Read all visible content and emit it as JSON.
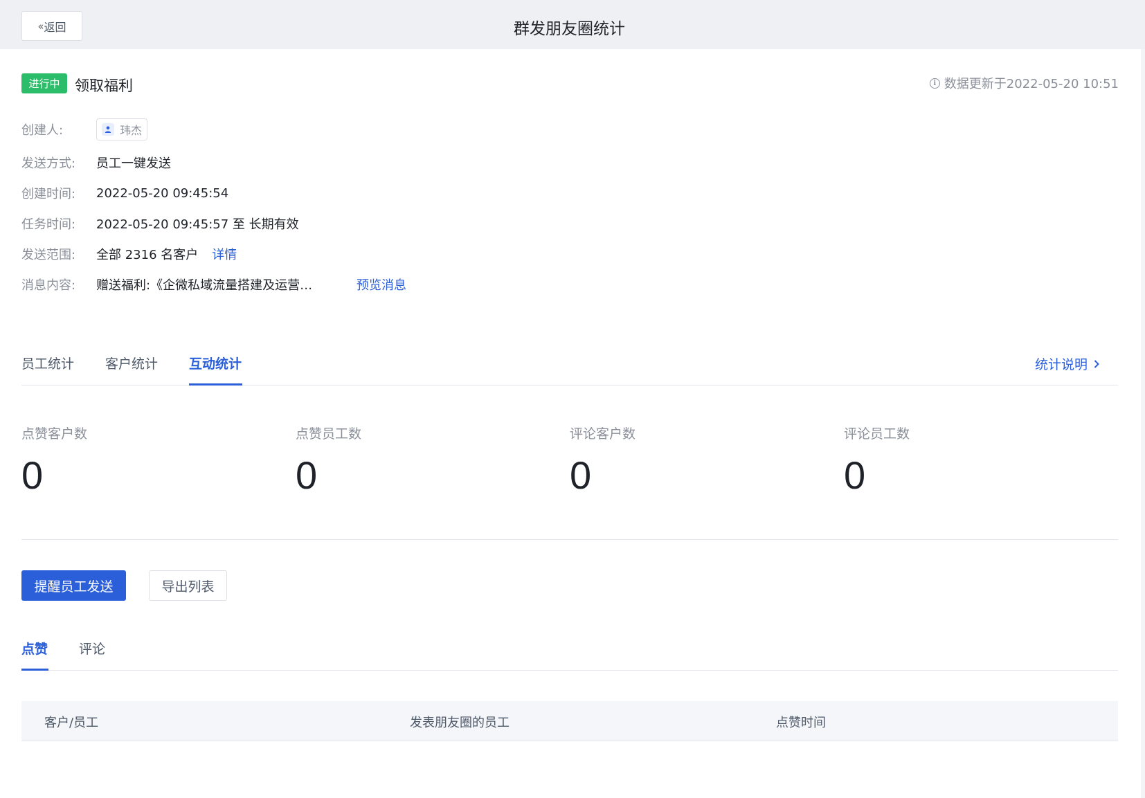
{
  "header": {
    "back_label": "返回",
    "back_icon": "double-chevron-left-icon",
    "title": "群发朋友圈统计"
  },
  "task": {
    "status": "进行中",
    "status_color": "#2bbd6a",
    "title": "领取福利",
    "update_info": "数据更新于2022-05-20 10:51"
  },
  "details": {
    "creator_label": "创建人:",
    "creator_name": "玮杰",
    "send_method_label": "发送方式:",
    "send_method": "员工一键发送",
    "created_label": "创建时间:",
    "created_time": "2022-05-20 09:45:54",
    "task_time_label": "任务时间:",
    "task_time": "2022-05-20 09:45:57 至 长期有效",
    "scope_label": "发送范围:",
    "scope": "全部 2316 名客户",
    "scope_link": "详情",
    "content_label": "消息内容:",
    "content": "赠送福利:《企微私域流量搭建及运营…",
    "content_link": "预览消息"
  },
  "tabs": {
    "items": [
      "员工统计",
      "客户统计",
      "互动统计"
    ],
    "active": "互动统计",
    "stats_link": "统计说明"
  },
  "metrics": [
    {
      "label": "点赞客户数",
      "value": "0"
    },
    {
      "label": "点赞员工数",
      "value": "0"
    },
    {
      "label": "评论客户数",
      "value": "0"
    },
    {
      "label": "评论员工数",
      "value": "0"
    }
  ],
  "actions": {
    "remind_label": "提醒员工发送",
    "export_label": "导出列表"
  },
  "subtabs": {
    "items": [
      "点赞",
      "评论"
    ],
    "active": "点赞"
  },
  "table": {
    "columns": [
      "客户/员工",
      "发表朋友圈的员工",
      "点赞时间"
    ]
  },
  "colors": {
    "accent": "#2b5fd9",
    "success": "#2bbd6a",
    "muted_text": "#8a8f99"
  }
}
